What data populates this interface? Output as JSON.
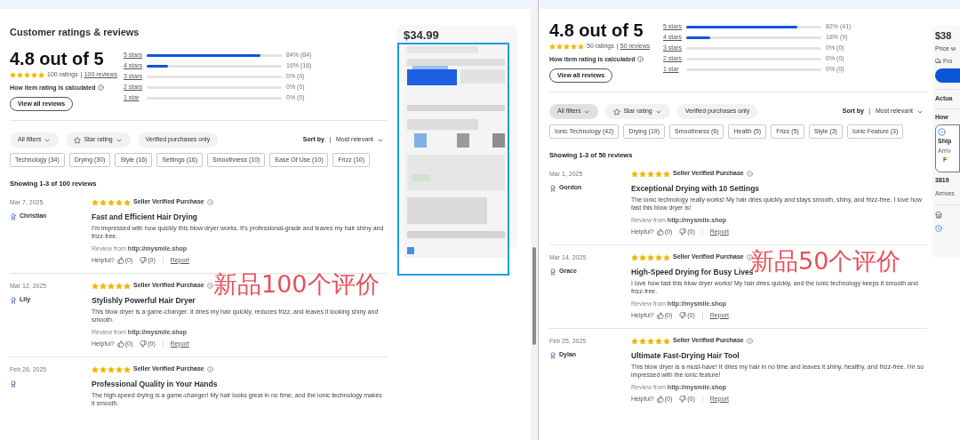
{
  "panels": [
    {
      "summary": {
        "heading": "Customer ratings & reviews",
        "rating": "4.8 out of 5",
        "stars": 5,
        "ratings": "100 ratings",
        "reviews_link": "100 reviews",
        "how": "How item rating is calculated",
        "view_all": "View all reviews"
      },
      "histogram": [
        {
          "label": "5 stars",
          "level": 0.84,
          "reading": "84% (84)"
        },
        {
          "label": "4 stars",
          "level": 0.16,
          "reading": "16% (16)"
        },
        {
          "label": "3 stars",
          "level": 0,
          "reading": "0% (0)"
        },
        {
          "label": "2 stars",
          "level": 0,
          "reading": "0% (0)"
        },
        {
          "label": "1 star",
          "level": 0,
          "reading": "0% (0)"
        }
      ],
      "filters": [
        {
          "label": "All filters",
          "kind": "dropdown",
          "selected": false
        },
        {
          "label": "Star rating",
          "kind": "star-dropdown",
          "selected": false
        },
        {
          "label": "Verified purchases only",
          "kind": "toggle",
          "selected": false
        }
      ],
      "sort": {
        "label": "Sort by",
        "value": "Most relevant"
      },
      "chips": [
        "Technology (34)",
        "Drying (30)",
        "Style (16)",
        "Settings (16)",
        "Smoothness (10)",
        "Ease Of Use (10)",
        "Frizz (10)"
      ],
      "showing": "Showing 1-3 of 100 reviews",
      "reviews": [
        {
          "date": "Mar 7, 2025",
          "name": "Christian",
          "stars": 5,
          "badge": "Seller Verified Purchase",
          "title": "Fast and Efficient Hair Drying",
          "body": "I'm impressed with how quickly this blow dryer works. It's professional-grade and leaves my hair shiny and frizz-free.",
          "source_label": "Review from",
          "source": "http://mysmile.shop",
          "helpful": "Helpful?",
          "up": "(0)",
          "down": "(0)",
          "report": "Report"
        },
        {
          "date": "Mar 12, 2025",
          "name": "Lily",
          "stars": 5,
          "badge": "Seller Verified Purchase",
          "title": "Stylishly Powerful Hair Dryer",
          "body": "This blow dryer is a game-changer. It dries my hair quickly, reduces frizz, and leaves it looking shiny and smooth.",
          "source_label": "Review from",
          "source": "http://mysmile.shop",
          "helpful": "Helpful?",
          "up": "(0)",
          "down": "(0)",
          "report": "Report"
        },
        {
          "date": "Feb 26, 2025",
          "stars": 5,
          "badge": "Seller Verified Purchase",
          "title": "Professional Quality in Your Hands",
          "body": "The high-speed drying is a game-changer! My hair looks great in no time, and the ionic technology makes it smooth."
        }
      ],
      "annotation": "新品100个评价",
      "side": {
        "kind": "picture",
        "price": "$34.99"
      }
    },
    {
      "summary": {
        "rating": "4.8 out of 5",
        "stars": 5,
        "ratings": "50 ratings",
        "reviews_link": "50 reviews",
        "how": "How item rating is calculated",
        "view_all": "View all reviews"
      },
      "histogram": [
        {
          "label": "5 stars",
          "level": 0.82,
          "reading": "82% (41)"
        },
        {
          "label": "4 stars",
          "level": 0.18,
          "reading": "18% (9)"
        },
        {
          "label": "3 stars",
          "level": 0,
          "reading": "0% (0)"
        },
        {
          "label": "2 stars",
          "level": 0,
          "reading": "0% (0)"
        },
        {
          "label": "1 star",
          "level": 0,
          "reading": "0% (0)"
        }
      ],
      "filters": [
        {
          "label": "All filters",
          "kind": "dropdown",
          "selected": true
        },
        {
          "label": "Star rating",
          "kind": "star-dropdown",
          "selected": false
        },
        {
          "label": "Verified purchases only",
          "kind": "toggle",
          "selected": false
        }
      ],
      "sort": {
        "label": "Sort by",
        "value": "Most relevant"
      },
      "chips": [
        "Ionic Technology (42)",
        "Drying (19)",
        "Smoothness (6)",
        "Health (5)",
        "Frizz (5)",
        "Style (3)",
        "Ionic Feature (3)"
      ],
      "showing": "Showing 1-3 of 50 reviews",
      "reviews": [
        {
          "date": "Mar 1, 2025",
          "name": "Gordon",
          "stars": 5,
          "badge": "Seller Verified Purchase",
          "title": "Exceptional Drying with 10 Settings",
          "body": "The ionic technology really works! My hair dries quickly and stays smooth, shiny, and frizz-free. I love how fast this blow dryer is!",
          "source_label": "Review from",
          "source": "http://mysmile.shop",
          "helpful": "Helpful?",
          "up": "(0)",
          "down": "(0)",
          "report": "Report"
        },
        {
          "date": "Mar 14, 2025",
          "name": "Grace",
          "stars": 5,
          "badge": "Seller Verified Purchase",
          "title": "High-Speed Drying for Busy Lives",
          "body": "I love how fast this blow dryer works! My hair dries quickly, and the ionic technology keeps it smooth and frizz-free.",
          "source_label": "Review from",
          "source": "http://mysmile.shop",
          "helpful": "Helpful?",
          "up": "(0)",
          "down": "(0)",
          "report": "Report"
        },
        {
          "date": "Feb 25, 2025",
          "name": "Dylan",
          "stars": 5,
          "badge": "Seller Verified Purchase",
          "title": "Ultimate Fast-Drying Hair Tool",
          "body": "This blow dryer is a must-have! It dries my hair in no time and leaves it shiny, healthy, and frizz-free. I'm so impressed with the ionic feature!",
          "source_label": "Review from",
          "source": "http://mysmile.shop",
          "helpful": "Helpful?",
          "up": "(0)",
          "down": "(0)",
          "report": "Report"
        }
      ],
      "annotation": "新品50个评价",
      "side": {
        "kind": "details",
        "price": "$38",
        "price_note": "Price w",
        "delivery": "Fro",
        "actual": "Actua",
        "how": "How",
        "option": {
          "title": "Ship",
          "note": "Arriv",
          "status": "F"
        },
        "address": "3819",
        "arrives": "Arrives"
      }
    }
  ]
}
